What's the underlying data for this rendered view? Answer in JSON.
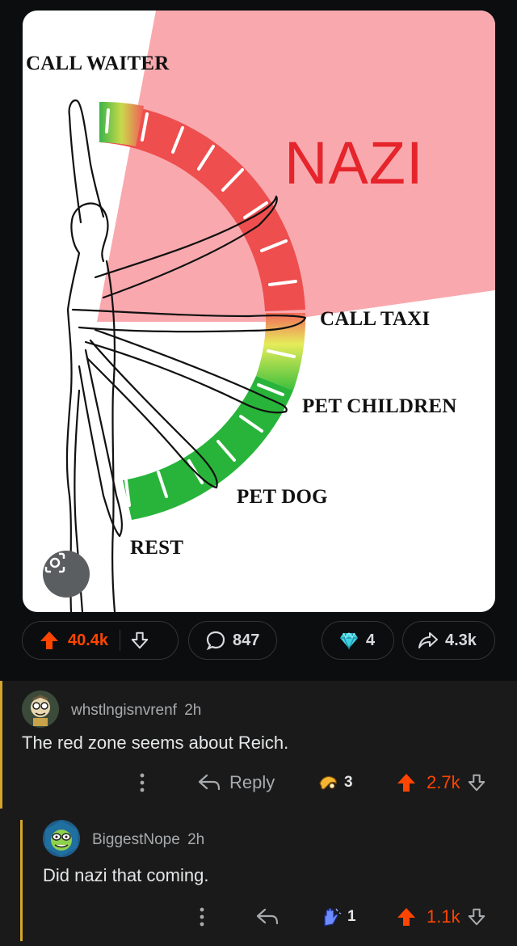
{
  "image": {
    "labels": {
      "call_waiter": "CALL WAITER",
      "nazi": "NAZI",
      "call_taxi": "CALL TAXI",
      "pet_children": "PET CHILDREN",
      "pet_dog": "PET DOG",
      "rest": "REST"
    }
  },
  "post_actions": {
    "upvotes": "40.4k",
    "comments": "847",
    "awards": "4",
    "shares": "4.3k"
  },
  "comments": [
    {
      "username": "whstlngisnvrenf",
      "age": "2h",
      "body": "The red zone seems about Reich.",
      "reply_label": "Reply",
      "award_count": "3",
      "score": "2.7k"
    },
    {
      "username": "BiggestNope",
      "age": "2h",
      "body": "Did nazi that coming.",
      "award_count": "1",
      "score": "1.1k"
    }
  ],
  "colors": {
    "background": "#0b0d0e",
    "comments_background": "#1a1a1b",
    "upvote": "#ff4500",
    "thread_line": "#d3a52a"
  },
  "icons": [
    "lens-icon",
    "upvote-arrow-icon",
    "downvote-arrow-icon",
    "comment-bubble-icon",
    "diamond-award-icon",
    "share-arrow-icon",
    "more-dots-icon",
    "reply-arrow-icon",
    "award-hand-icon"
  ]
}
